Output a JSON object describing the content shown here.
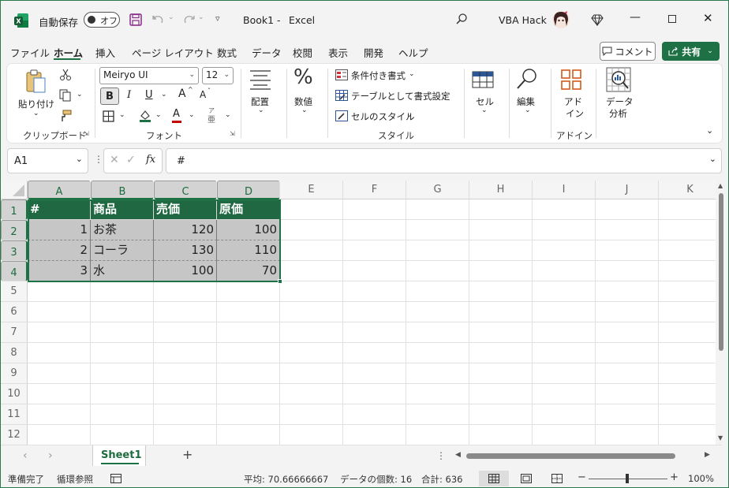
{
  "titlebar": {
    "autosave_label": "自動保存",
    "autosave_toggle": "オフ",
    "doc_title": "Book1",
    "title_sep": "-",
    "app_name": "Excel",
    "user_name": "VBA Hack"
  },
  "menu": {
    "items": [
      "ファイル",
      "ホーム",
      "挿入",
      "ページ レイアウト",
      "数式",
      "データ",
      "校閲",
      "表示",
      "開発",
      "ヘルプ"
    ],
    "active": "ホーム",
    "comment_button": "コメント",
    "share_button": "共有"
  },
  "ribbon": {
    "clipboard": {
      "paste": "貼り付け",
      "label": "クリップボード"
    },
    "font": {
      "name": "Meiryo UI",
      "size": "12",
      "bold": "B",
      "italic": "I",
      "underline": "U",
      "grow": "A",
      "shrink": "A",
      "color_a": "A",
      "phonetic": "ア",
      "label": "フォント"
    },
    "alignment": {
      "label": "配置"
    },
    "number": {
      "symbol": "%",
      "label": "数値"
    },
    "styles": {
      "conditional": "条件付き書式",
      "table": "テーブルとして書式設定",
      "cell_styles": "セルのスタイル",
      "label": "スタイル"
    },
    "cells": {
      "label": "セル"
    },
    "editing": {
      "label": "編集"
    },
    "addins": {
      "line1": "アド",
      "line2": "イン",
      "group_label": "アドイン"
    },
    "analysis": {
      "line1": "データ",
      "line2": "分析"
    }
  },
  "formula_bar": {
    "name_box": "A1",
    "fx": "fx",
    "content": "#"
  },
  "grid": {
    "columns": [
      "A",
      "B",
      "C",
      "D",
      "E",
      "F",
      "G",
      "H",
      "I",
      "J",
      "K"
    ],
    "rows": [
      "1",
      "2",
      "3",
      "4",
      "5",
      "6",
      "7",
      "8",
      "9",
      "10",
      "11",
      "12"
    ],
    "header": [
      "#",
      "商品",
      "売価",
      "原価"
    ],
    "data": [
      [
        "1",
        "お茶",
        "120",
        "100"
      ],
      [
        "2",
        "コーラ",
        "130",
        "110"
      ],
      [
        "3",
        "水",
        "100",
        "70"
      ]
    ]
  },
  "sheets": {
    "tabs": [
      "Sheet1"
    ],
    "add": "+"
  },
  "status": {
    "ready": "準備完了",
    "circular": "循環参照",
    "average": "平均: 70.66666667",
    "count": "データの個数: 16",
    "sum": "合計: 636",
    "zoom": "100%"
  },
  "colors": {
    "accent": "#1e7145",
    "header_fill": "#206841",
    "data_fill": "#c6c6c6"
  }
}
